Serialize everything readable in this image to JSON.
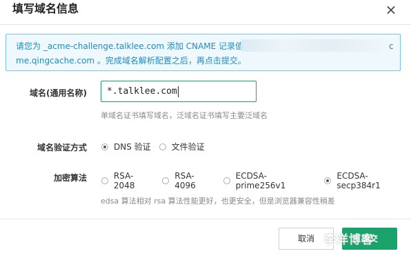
{
  "dialog": {
    "title": "填写域名信息",
    "close_symbol": "×"
  },
  "notice": {
    "line1": "请您为 _acme-challenge.talklee.com 添加 CNAME 记录值",
    "line1_tail": "c",
    "line2": "me.qingcache.com 。完成域名解析配置之后，再点击提交。"
  },
  "form": {
    "domain": {
      "label": "域名(通用名称)",
      "value": "*.talklee.com",
      "hint": "单域名证书填写域名，泛域名证书填写主要泛域名"
    },
    "verify": {
      "label": "域名验证方式",
      "options": [
        "DNS 验证",
        "文件验证"
      ],
      "selected": "DNS 验证"
    },
    "algo": {
      "label": "加密算法",
      "options": [
        "RSA-2048",
        "RSA-4096",
        "ECDSA-prime256v1",
        "ECDSA-secp384r1"
      ],
      "selected": "ECDSA-secp384r1",
      "hint": "edsa 算法相对 rsa 算法性能更好，也更安全，但是浏览器兼容性稍差"
    }
  },
  "footer": {
    "cancel_label": "取消",
    "submit_label": "提交",
    "watermark": "李洋博客"
  },
  "colors": {
    "accent": "#1aa36b",
    "notice_text": "#1f8dc9",
    "notice_border": "#79c8e6",
    "notice_bg": "#eef8fd"
  }
}
